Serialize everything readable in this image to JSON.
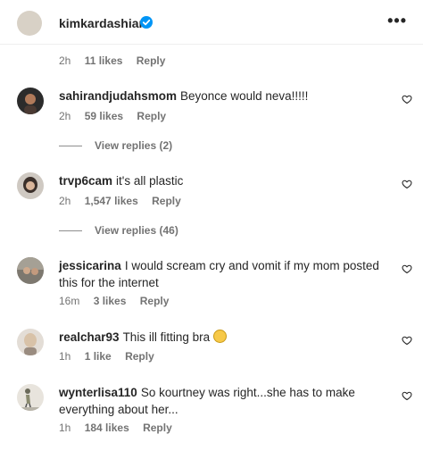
{
  "header": {
    "username": "kimkardashian",
    "more_label": "•••",
    "time": "2h",
    "likes": "11 likes",
    "reply": "Reply"
  },
  "comments": [
    {
      "username": "sahirandjudahsmom",
      "text": "Beyonce would neva!!!!!",
      "time": "2h",
      "likes": "59 likes",
      "reply": "Reply",
      "view_replies": "View replies (2)"
    },
    {
      "username": "trvp6cam",
      "text": "it's all plastic",
      "time": "2h",
      "likes": "1,547 likes",
      "reply": "Reply",
      "view_replies": "View replies (46)"
    },
    {
      "username": "jessicarina",
      "text": "I would scream cry and vomit if my mom posted this for the internet",
      "time": "16m",
      "likes": "3 likes",
      "reply": "Reply"
    },
    {
      "username": "realchar93",
      "text": "This ill fitting bra",
      "emoji": "worried-face-emoji",
      "time": "1h",
      "likes": "1 like",
      "reply": "Reply"
    },
    {
      "username": "wynterlisa110",
      "text": "So kourtney was right...she has to make everything about her...",
      "time": "1h",
      "likes": "184 likes",
      "reply": "Reply"
    }
  ],
  "icons": {
    "verified": "verified-badge-icon",
    "like": "heart-icon",
    "more": "more-options-icon"
  },
  "colors": {
    "verified_blue": "#0095f6",
    "meta_gray": "#737373",
    "text": "#262626"
  }
}
